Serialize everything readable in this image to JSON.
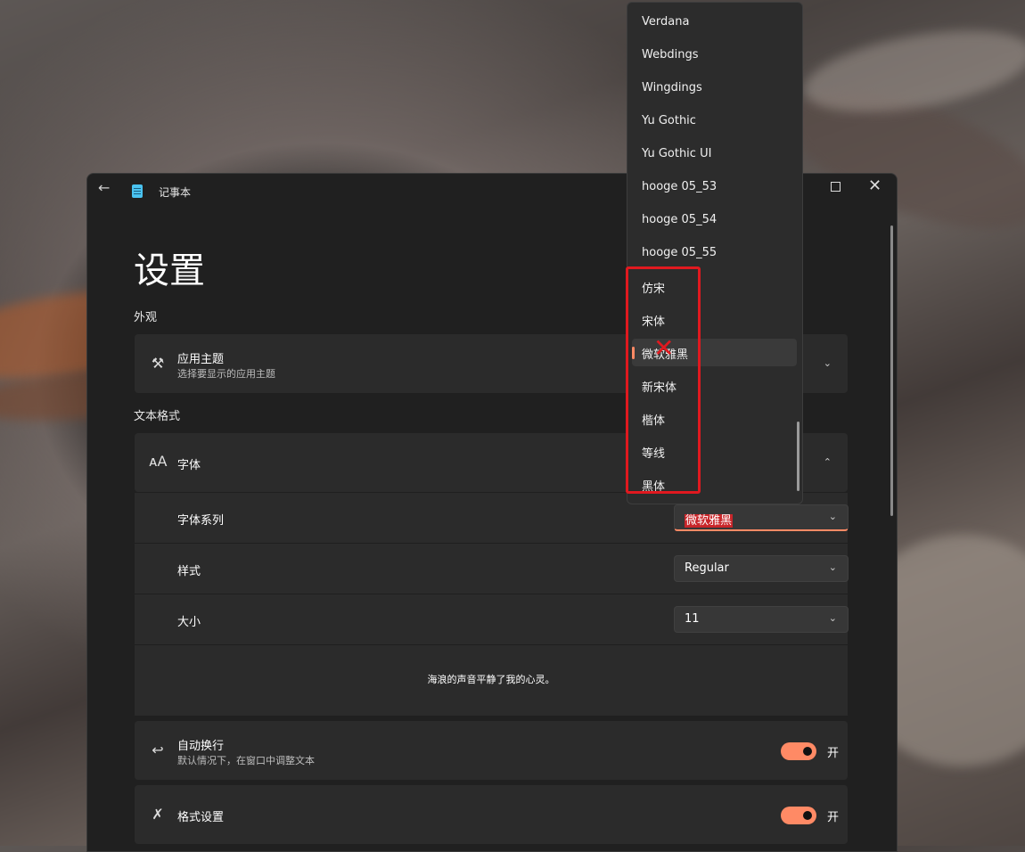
{
  "window": {
    "title": "记事本"
  },
  "page": {
    "title": "设置"
  },
  "appearance": {
    "section_title": "外观",
    "theme_title": "应用主题",
    "theme_subtitle": "选择要显示的应用主题"
  },
  "text_format": {
    "section_title": "文本格式",
    "font_title": "字体",
    "family_label": "字体系列",
    "family_value": "微软雅黑",
    "style_label": "样式",
    "style_value": "Regular",
    "size_label": "大小",
    "size_value": "11",
    "preview_text": "海浪的声音平静了我的心灵。"
  },
  "wrap": {
    "title": "自动换行",
    "subtitle": "默认情况下，在窗口中调整文本",
    "state_label": "开",
    "on": true
  },
  "formatting": {
    "title": "格式设置",
    "state_label": "开",
    "on": true
  },
  "font_list": {
    "options": [
      "Verdana",
      "Webdings",
      "Wingdings",
      "Yu Gothic",
      "Yu Gothic UI",
      "hooge 05_53",
      "hooge 05_54",
      "hooge 05_55",
      "仿宋",
      "宋体",
      "微软雅黑",
      "新宋体",
      "楷体",
      "等线",
      "黑体"
    ],
    "selected": "微软雅黑"
  },
  "colors": {
    "accent": "#ff8a65",
    "annotation_red": "#e0191f"
  }
}
